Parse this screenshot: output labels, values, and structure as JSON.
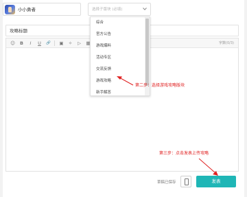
{
  "header": {
    "game_name": "小小勇者",
    "section_select": {
      "placeholder": "选择子版块 (必填)",
      "icon": "chevron-down-icon"
    }
  },
  "title_input": {
    "value": "攻略标题"
  },
  "editor": {
    "toolbar": [
      {
        "name": "emoji",
        "glyph": "☺"
      },
      {
        "name": "bold",
        "glyph": "B"
      },
      {
        "name": "italic",
        "glyph": "I"
      },
      {
        "name": "underline",
        "glyph": "U"
      },
      {
        "name": "link",
        "glyph": "🔗"
      },
      {
        "name": "image",
        "glyph": "▣"
      },
      {
        "name": "sparkle",
        "glyph": "✧"
      },
      {
        "name": "video",
        "glyph": "▷"
      },
      {
        "name": "table",
        "glyph": "▦"
      }
    ],
    "word_count": "字数(0/3)"
  },
  "dropdown": {
    "items": [
      "综合",
      "官方公告",
      "游戏爆料",
      "活动专区",
      "交流反馈",
      "游戏攻略",
      "新手解答"
    ]
  },
  "annotations": {
    "step2": "第二步：选择游戏攻略版块",
    "step3": "第三步：点击发表上传攻略",
    "color": "#e02020"
  },
  "footer": {
    "draft_status": "草稿已保存",
    "publish_label": "发表",
    "publish_color": "#1fb6b6"
  }
}
